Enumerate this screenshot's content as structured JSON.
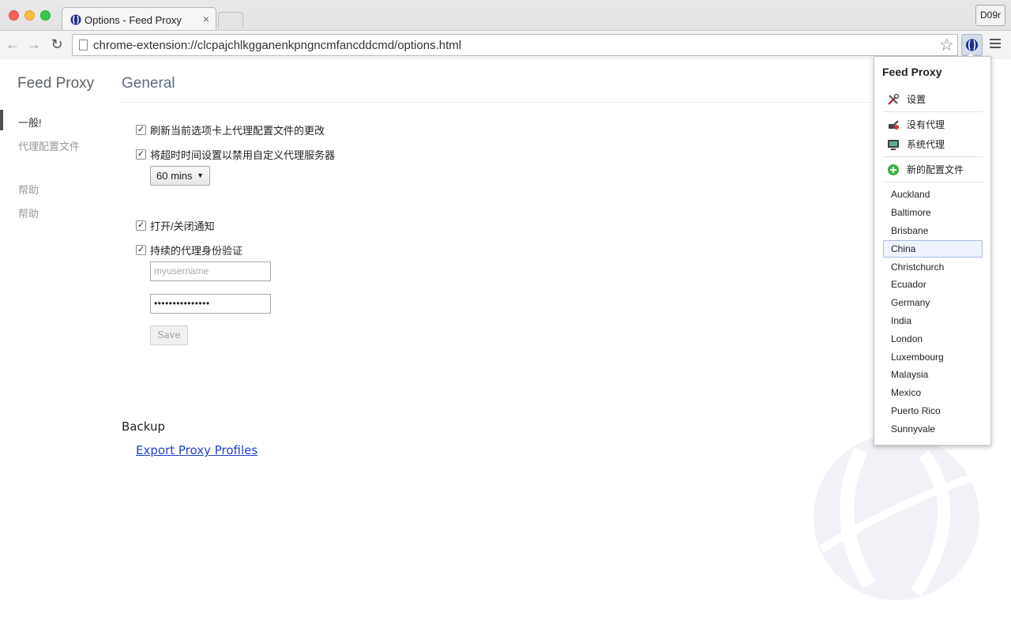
{
  "window": {
    "tab_title": "Options - Feed Proxy",
    "tab_close": "×",
    "profile_button": "D09r",
    "url": "chrome-extension://clcpajchlkgganenkpngncmfancddcmd/options.html"
  },
  "sidebar": {
    "app_title": "Feed Proxy",
    "items": [
      {
        "label": "一般!"
      },
      {
        "label": "代理配置文件"
      },
      {
        "label": "帮助"
      },
      {
        "label": "帮助"
      }
    ]
  },
  "general": {
    "title": "General",
    "options": [
      {
        "label": "刷新当前选项卡上代理配置文件的更改",
        "checked": true
      },
      {
        "label": "将超时时间设置以禁用自定义代理服务器",
        "checked": true
      },
      {
        "label": "打开/关闭通知",
        "checked": true
      },
      {
        "label": "持续的代理身份验证",
        "checked": true
      }
    ],
    "timeout_value": "60 mins",
    "username_placeholder": "myusername",
    "password_value": "•••••••••••••••",
    "save_label": "Save"
  },
  "backup": {
    "title": "Backup",
    "export_link": "Export Proxy Profiles"
  },
  "popup": {
    "title": "Feed Proxy",
    "settings": "设置",
    "direct": "没有代理",
    "system": "系统代理",
    "new_profile": "新的配置文件",
    "profiles": [
      "Auckland",
      "Baltimore",
      "Brisbane",
      "China",
      "Christchurch",
      "Ecuador",
      "Germany",
      "India",
      "London",
      "Luxembourg",
      "Malaysia",
      "Mexico",
      "Puerto Rico",
      "Sunnyvale"
    ],
    "selected_profile": "China"
  },
  "icons": {
    "settings": "tools-icon",
    "direct": "plug-icon",
    "system": "monitor-icon",
    "new_profile": "add-circle-icon"
  },
  "colors": {
    "accent": "#5c6b80",
    "link": "#1e43c9",
    "add_green": "#3cb043"
  }
}
